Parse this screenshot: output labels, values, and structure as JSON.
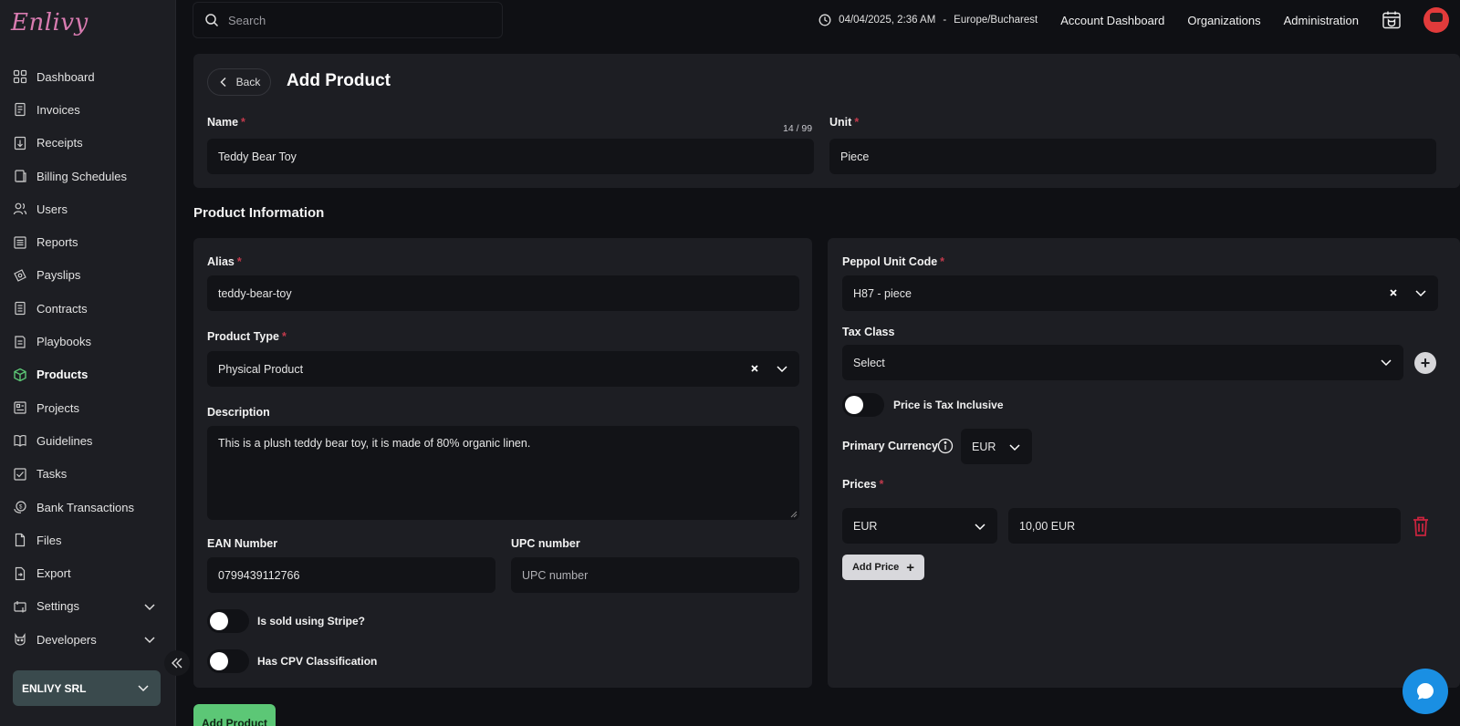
{
  "app": {
    "logo_text": "Enlivy"
  },
  "sidebar": {
    "items": [
      {
        "label": "Dashboard",
        "icon": "dashboard-icon"
      },
      {
        "label": "Invoices",
        "icon": "invoice-icon"
      },
      {
        "label": "Receipts",
        "icon": "receipt-icon"
      },
      {
        "label": "Billing Schedules",
        "icon": "billing-icon"
      },
      {
        "label": "Users",
        "icon": "users-icon"
      },
      {
        "label": "Reports",
        "icon": "reports-icon"
      },
      {
        "label": "Payslips",
        "icon": "payslips-icon"
      },
      {
        "label": "Contracts",
        "icon": "contracts-icon"
      },
      {
        "label": "Playbooks",
        "icon": "playbooks-icon"
      },
      {
        "label": "Products",
        "icon": "products-icon",
        "active": true
      },
      {
        "label": "Projects",
        "icon": "projects-icon"
      },
      {
        "label": "Guidelines",
        "icon": "guidelines-icon"
      },
      {
        "label": "Tasks",
        "icon": "tasks-icon"
      },
      {
        "label": "Bank Transactions",
        "icon": "bank-icon"
      },
      {
        "label": "Files",
        "icon": "files-icon"
      },
      {
        "label": "Export",
        "icon": "export-icon"
      },
      {
        "label": "Settings",
        "icon": "settings-icon",
        "expandable": true
      },
      {
        "label": "Developers",
        "icon": "developers-icon",
        "expandable": true
      }
    ],
    "org_name": "ENLIVY SRL"
  },
  "topbar": {
    "search_placeholder": "Search",
    "datetime": "04/04/2025, 2:36 AM",
    "separator": "-",
    "timezone": "Europe/Bucharest",
    "links": [
      "Account Dashboard",
      "Organizations",
      "Administration"
    ]
  },
  "header": {
    "back_label": "Back",
    "title": "Add Product",
    "name_label": "Name",
    "name_value": "Teddy Bear Toy",
    "name_counter": "14 / 99",
    "unit_label": "Unit",
    "unit_value": "Piece"
  },
  "section_title": "Product Information",
  "left": {
    "alias_label": "Alias",
    "alias_value": "teddy-bear-toy",
    "product_type_label": "Product Type",
    "product_type_value": "Physical Product",
    "description_label": "Description",
    "description_value": "This is a plush teddy bear toy, it is made of 80% organic linen.",
    "ean_label": "EAN Number",
    "ean_value": "0799439112766",
    "upc_label": "UPC number",
    "upc_placeholder": "UPC number",
    "stripe_label": "Is sold using Stripe?",
    "cpv_label": "Has CPV Classification"
  },
  "right": {
    "peppol_label": "Peppol Unit Code",
    "peppol_value": "H87 - piece",
    "tax_class_label": "Tax Class",
    "tax_class_placeholder": "Select",
    "tax_inclusive_label": "Price is Tax Inclusive",
    "primary_currency_label": "Primary Currency",
    "primary_currency_value": "EUR",
    "prices_label": "Prices",
    "price_currency": "EUR",
    "price_value": "10,00 EUR",
    "add_price_label": "Add Price"
  },
  "submit_label": "Add Product",
  "required_mark": "*",
  "colors": {
    "accent_green": "#5cc776",
    "required_red": "#c23a4c",
    "trash_red": "#c8243e",
    "chat_blue": "#1a8fe3"
  }
}
